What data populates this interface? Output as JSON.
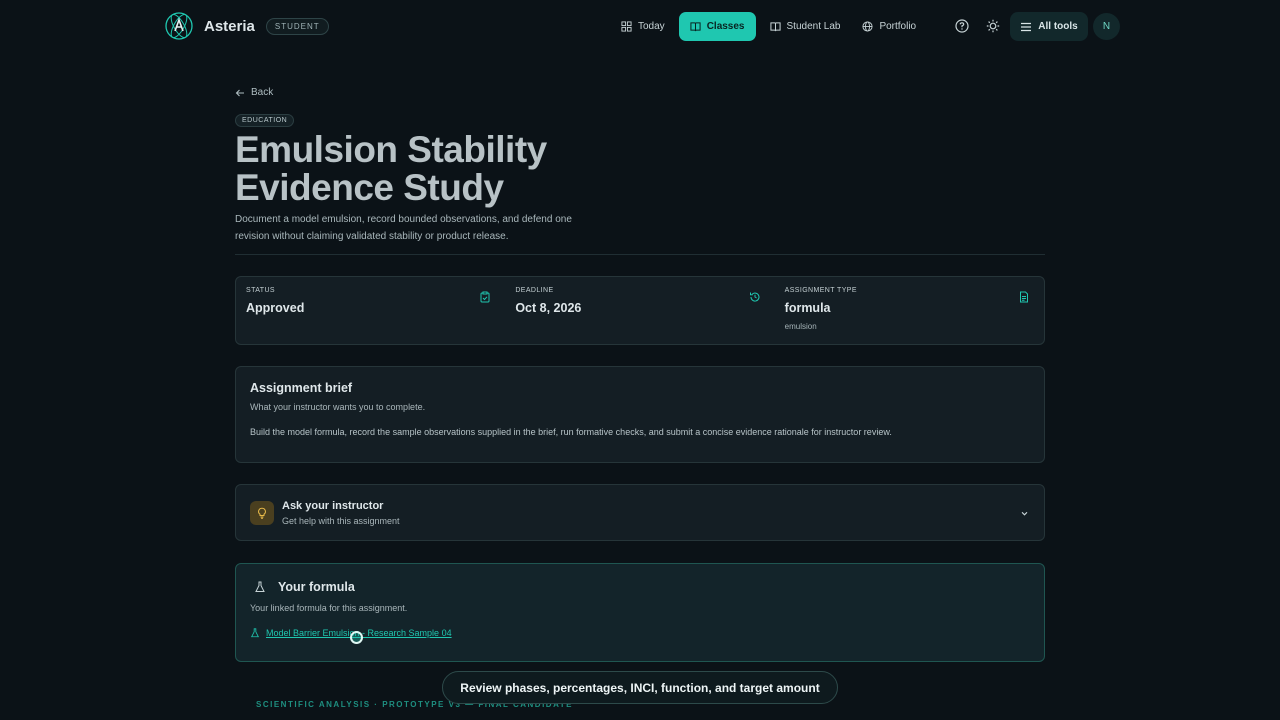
{
  "app": {
    "name": "Asteria",
    "role_badge": "STUDENT"
  },
  "nav": {
    "today": "Today",
    "classes": "Classes",
    "student_lab": "Student Lab",
    "portfolio": "Portfolio"
  },
  "toolbar": {
    "all_tools": "All tools",
    "avatar_initial": "N"
  },
  "page": {
    "back_label": "Back",
    "category_tag": "EDUCATION",
    "title_line1": "Emulsion Stability",
    "title_line2": "Evidence Study",
    "subtitle": "Document a model emulsion, record bounded observations, and defend one revision without claiming validated stability or product release."
  },
  "stats": {
    "status": {
      "label": "STATUS",
      "value": "Approved"
    },
    "deadline": {
      "label": "DEADLINE",
      "value": "Oct 8, 2026"
    },
    "type": {
      "label": "ASSIGNMENT TYPE",
      "value": "formula",
      "sub": "emulsion"
    }
  },
  "brief": {
    "title": "Assignment brief",
    "subtitle": "What your instructor wants you to complete.",
    "body": "Build the model formula, record the sample observations supplied in the brief, run formative checks, and submit a concise evidence rationale for instructor review."
  },
  "ask": {
    "title": "Ask your instructor",
    "subtitle": "Get help with this assignment"
  },
  "formula": {
    "title": "Your formula",
    "subtitle": "Your linked formula for this assignment.",
    "link": "Model Barrier Emulsion - Research Sample 04"
  },
  "next_section": {
    "label": "SCIENTIFIC ANALYSIS · PROTOTYPE V3 — FINAL CANDIDATE"
  },
  "toast": {
    "text": "Review phases, percentages, INCI, function, and target amount"
  },
  "colors": {
    "accent": "#1fc7b0",
    "background": "#0b1217",
    "card": "#141e24"
  }
}
